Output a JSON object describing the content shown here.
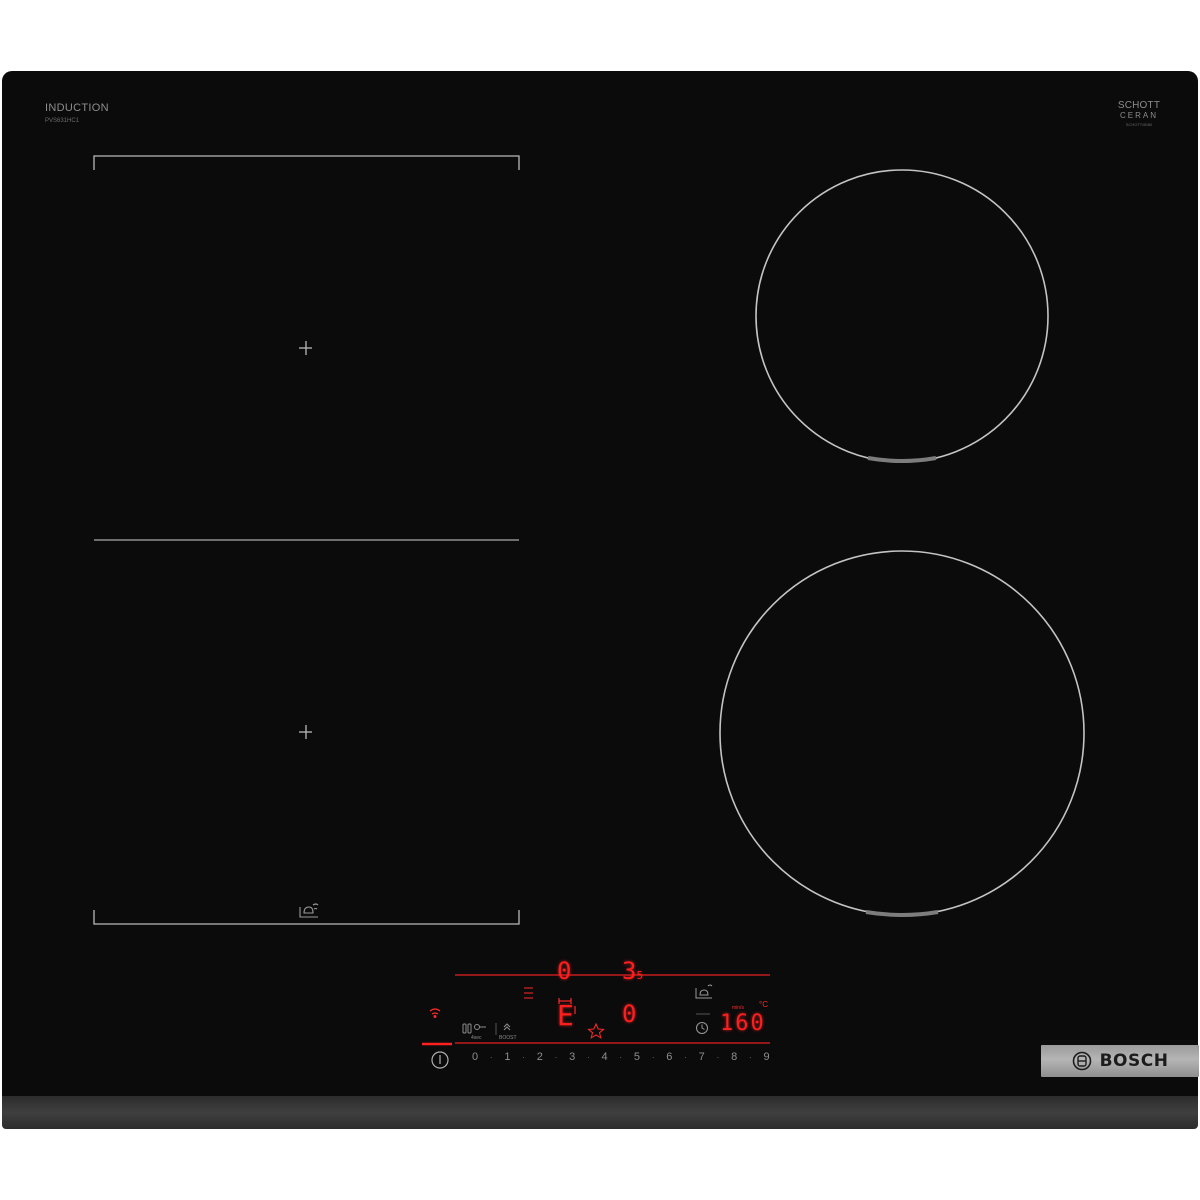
{
  "product": {
    "type_label": "INDUCTION",
    "model": "PVS631HC1",
    "glass_brand_line1": "SCHOTT",
    "glass_brand_line2": "CERAN",
    "glass_brand_line3": "SCHOTT/8080",
    "brand": "BOSCH"
  },
  "display": {
    "zone_left_top": "0",
    "zone_right_power": "3",
    "zone_right_power_sub": "5",
    "zone_left_bottom": "E",
    "zone_right_bottom": "0",
    "timer_temp": "160",
    "temp_unit": "°C",
    "temp_hint": "min/s"
  },
  "controls": {
    "lock_label": "4sec",
    "boost_label": "BOOST",
    "power_scale": [
      "0",
      "1",
      "2",
      "3",
      "4",
      "5",
      "6",
      "7",
      "8",
      "9"
    ]
  },
  "colors": {
    "glass": "#0b0b0b",
    "led_red": "#ff1e1e",
    "outline": "#b9b9b9",
    "brand_plate": "#a8a8a8"
  },
  "icons": [
    "power-icon",
    "wifi-icon",
    "lock-icon",
    "boost-icon",
    "favorite-star-icon",
    "timer-clock-icon",
    "cooking-sensor-icon",
    "pan-sensor-icon"
  ]
}
